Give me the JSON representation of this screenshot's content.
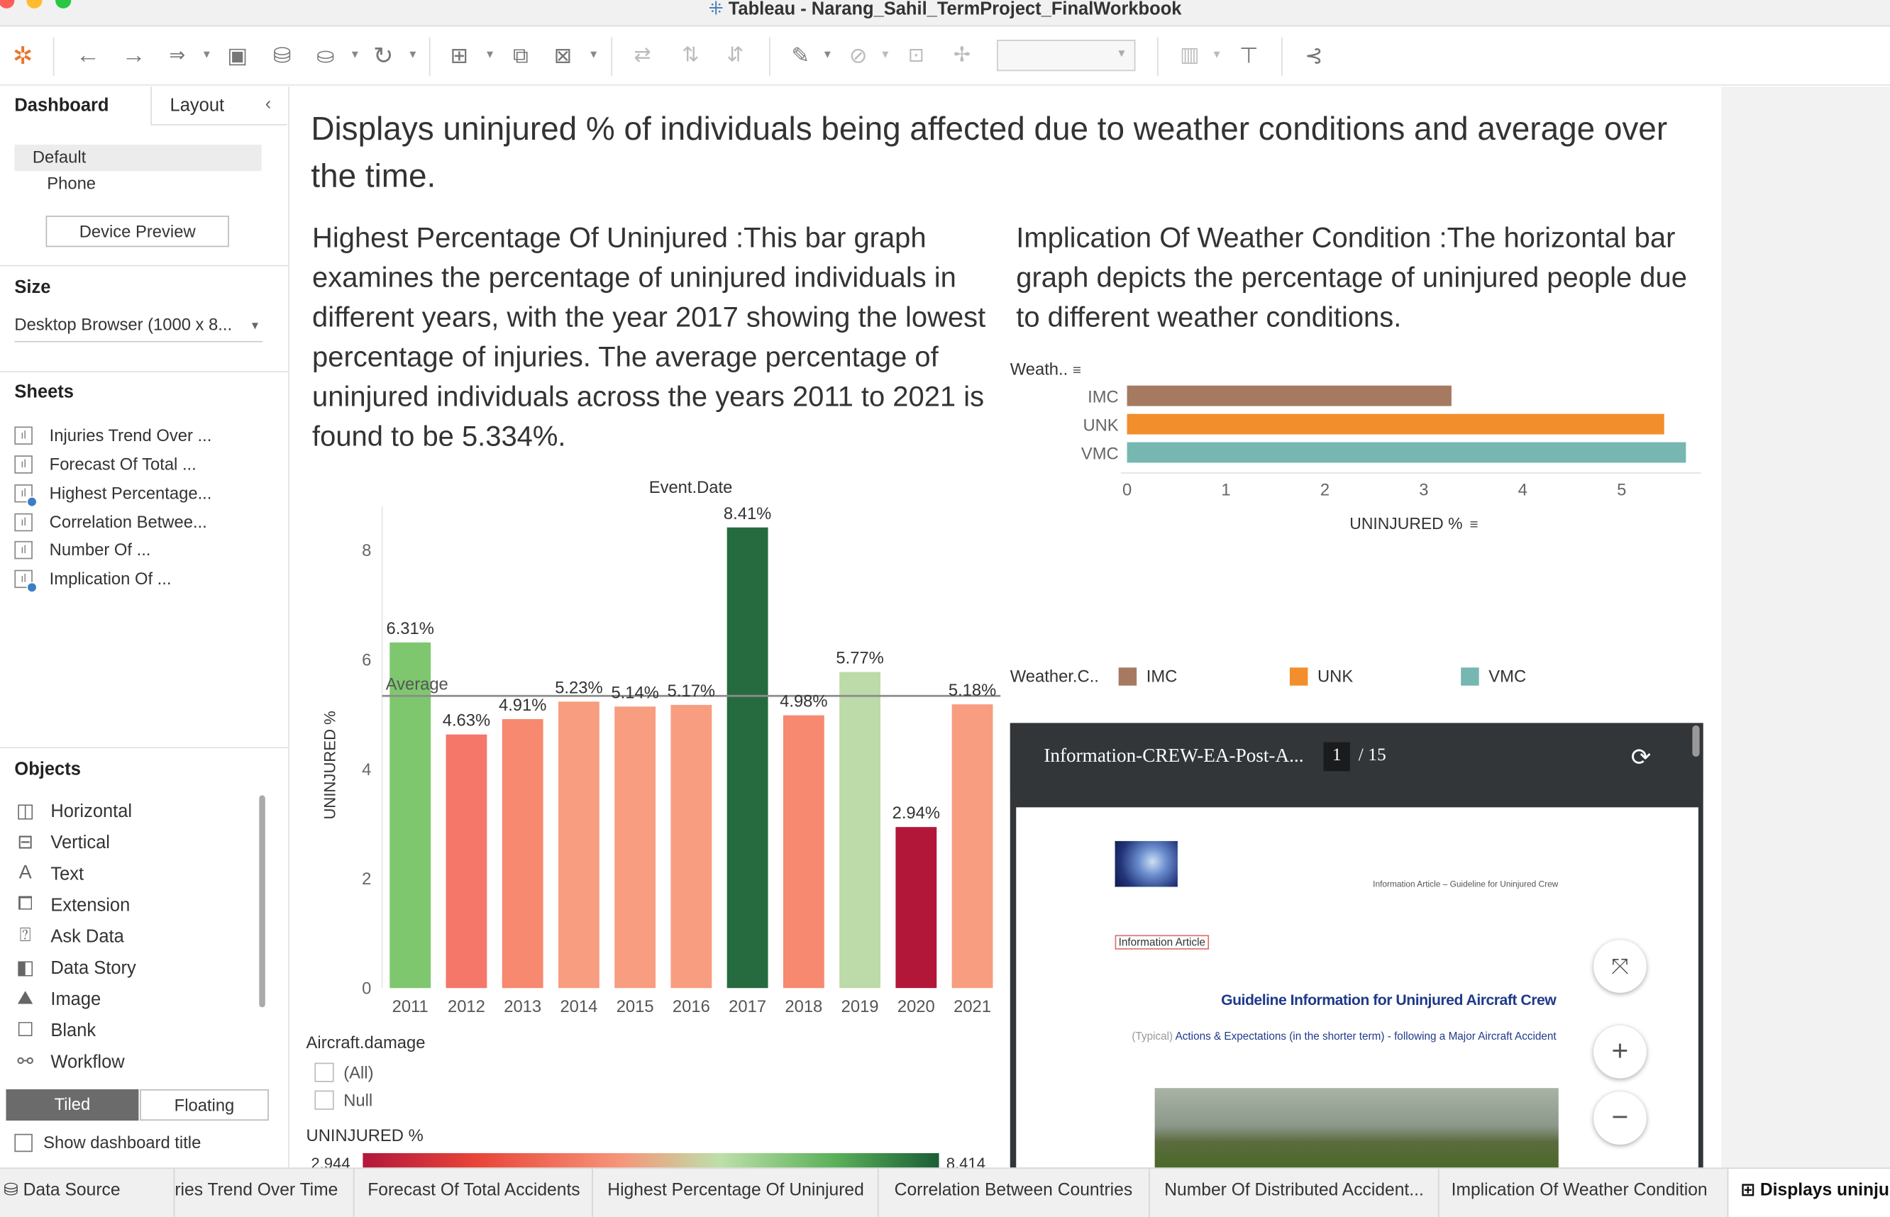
{
  "window": {
    "title": "Tableau - Narang_Sahil_TermProject_FinalWorkbook"
  },
  "toolbar": {
    "items": [
      "tableau-logo-icon",
      "undo-icon",
      "redo-icon",
      "swap-icon",
      "save-icon",
      "add-datasource-icon",
      "pause-updates-icon",
      "refresh-icon",
      "new-sheet-icon",
      "duplicate-sheet-icon",
      "clear-sheet-icon",
      "swap-rows-icon",
      "sort-asc-icon",
      "sort-desc-icon",
      "highlight-icon",
      "group-icon",
      "label-icon",
      "pin-icon",
      "fit-selector",
      "show-me-icon",
      "presentation-icon",
      "share-icon"
    ]
  },
  "left_pane": {
    "tabs": {
      "dashboard": "Dashboard",
      "layout": "Layout"
    },
    "device": {
      "default": "Default",
      "phone": "Phone",
      "preview": "Device Preview"
    },
    "size": {
      "heading": "Size",
      "value": "Desktop Browser (1000 x 8..."
    },
    "sheets": {
      "heading": "Sheets",
      "items": [
        "Injuries Trend Over ...",
        "Forecast Of Total ...",
        "Highest Percentage...",
        "Correlation Betwee...",
        "Number Of ...",
        "Implication Of ..."
      ]
    },
    "objects": {
      "heading": "Objects",
      "items": [
        "Horizontal",
        "Vertical",
        "Text",
        "Extension",
        "Ask Data",
        "Data Story",
        "Image",
        "Blank",
        "Workflow"
      ]
    },
    "tiled": "Tiled",
    "floating": "Floating",
    "show_title": "Show dashboard title"
  },
  "dashboard": {
    "title": "Displays uninjured % of individuals being affected due to weather conditions and average over the time.",
    "desc_left": "Highest Percentage Of Uninjured  :This bar graph examines the percentage of uninjured individuals in different years, with the year 2017 showing the lowest percentage of injuries. The average percentage of uninjured individuals across the years 2011 to 2021 is found to be 5.334%.",
    "desc_right": "Implication Of Weather Condition :The horizontal bar graph depicts the percentage of uninjured people due to different weather conditions.",
    "filter": {
      "title": "Aircraft.damage",
      "items": [
        "(All)",
        "Null"
      ]
    },
    "gradient": {
      "title": "UNINJURED %",
      "min": "2.944",
      "max": "8.414",
      "colors": [
        "#b2173a",
        "#e9453a",
        "#f6967b",
        "#bde0a8",
        "#5ab05a",
        "#1a5e35"
      ]
    },
    "legend": {
      "title": "Weather.C..",
      "items": [
        {
          "name": "IMC",
          "color": "#a67a61"
        },
        {
          "name": "UNK",
          "color": "#f28e2c"
        },
        {
          "name": "VMC",
          "color": "#76b7b2"
        }
      ]
    }
  },
  "chart_data": [
    {
      "type": "bar",
      "title": "Event.Date",
      "ylabel": "UNINJURED %",
      "categories": [
        "2011",
        "2012",
        "2013",
        "2014",
        "2015",
        "2016",
        "2017",
        "2018",
        "2019",
        "2020",
        "2021"
      ],
      "values": [
        6.31,
        4.63,
        4.91,
        5.23,
        5.14,
        5.17,
        8.41,
        4.98,
        5.77,
        2.94,
        5.18
      ],
      "data_labels": [
        "6.31%",
        "4.63%",
        "4.91%",
        "5.23%",
        "5.14%",
        "5.17%",
        "8.41%",
        "4.98%",
        "5.77%",
        "2.94%",
        "5.18%"
      ],
      "colors": [
        "#7ec76f",
        "#f4776a",
        "#f6896f",
        "#f89d80",
        "#f89d80",
        "#f89d80",
        "#256b3f",
        "#f6896f",
        "#bddaa9",
        "#b2173a",
        "#f89d80"
      ],
      "reference_line": {
        "label": "Average",
        "value": 5.334
      },
      "yticks": [
        0,
        2,
        4,
        6,
        8
      ],
      "ylim": [
        0,
        8.8
      ]
    },
    {
      "type": "bar",
      "orientation": "horizontal",
      "ylabel": "Weath..",
      "xlabel": "UNINJURED %",
      "categories": [
        "IMC",
        "UNK",
        "VMC"
      ],
      "values": [
        3.28,
        5.43,
        5.65
      ],
      "colors": [
        "#a67a61",
        "#f28e2c",
        "#76b7b2"
      ],
      "xticks": [
        0,
        1,
        2,
        3,
        4,
        5
      ],
      "xlim": [
        0,
        5.8
      ]
    }
  ],
  "pdf": {
    "name": "Information-CREW-EA-Post-A...",
    "page": "1",
    "total": "/ 15",
    "header": "Information Article – Guideline for Uninjured Crew",
    "tag": "Information Article",
    "heading": "Guideline Information for Uninjured Aircraft Crew",
    "sub_prefix": "(Typical)",
    "sub": "Actions & Expectations (in the shorter term) - following a Major Aircraft Accident"
  },
  "bottom_tabs": [
    "Data Source",
    "ries Trend Over Time",
    "Forecast Of Total Accidents",
    "Highest Percentage Of Uninjured",
    "Correlation Between Countries",
    "Number Of Distributed Accident...",
    "Implication Of Weather Condition",
    "Displays uninju"
  ]
}
